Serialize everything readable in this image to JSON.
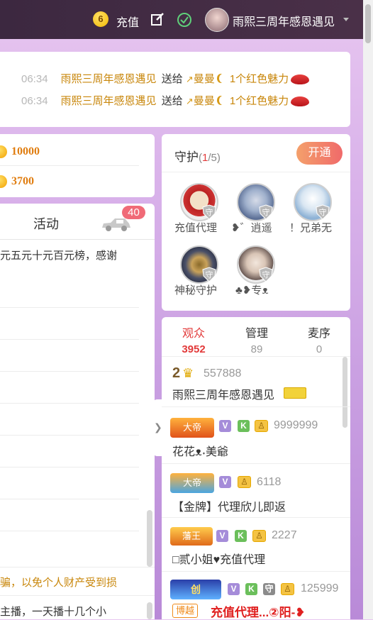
{
  "topbar": {
    "coin_level": "6",
    "recharge_label": "充值",
    "user_name": "雨熙三周年感恩遇见"
  },
  "gift_feed": [
    {
      "time": "06:34",
      "sender": "雨熙三周年感恩遇见",
      "verb": "送给",
      "receiver": "曼曼",
      "gift": "1个红色魅力"
    },
    {
      "time": "06:34",
      "sender": "雨熙三周年感恩遇见",
      "verb": "送给",
      "receiver": "曼曼",
      "gift": "1个红色魅力"
    }
  ],
  "rank": {
    "values": [
      "10000",
      "3700"
    ]
  },
  "chat": {
    "tab_label": "活动",
    "badge_count": "40",
    "first_line": "元五元十元百元榜，感谢",
    "warning": "骗，以免个人财产受到损",
    "last_line": "主播，一天播十几个小"
  },
  "guard": {
    "title": "守护",
    "count_current": "1",
    "count_total": "/5",
    "open_label": "开通",
    "members": [
      {
        "name": "充值代理"
      },
      {
        "name": "❥゛逍遥"
      },
      {
        "name": "！兄弟无"
      },
      {
        "name": "神秘守护"
      },
      {
        "name": "♣❥专ᴥ"
      }
    ],
    "shield_label": "守"
  },
  "audience": {
    "tabs": [
      {
        "label": "观众",
        "count": "3952"
      },
      {
        "label": "管理",
        "count": "89"
      },
      {
        "label": "麦序",
        "count": "0"
      }
    ],
    "rows": [
      {
        "rank_num": "2",
        "id": "557888",
        "name": "雨熙三周年感恩遇见"
      },
      {
        "title_badge": "大帝",
        "id": "9999999",
        "name": "花花ᴥ˖美爺"
      },
      {
        "title_badge": "大帝",
        "id": "6118",
        "name": "【金牌】代理欣儿即返"
      },
      {
        "title_badge": "藩王",
        "id": "2227",
        "name": "□贰小姐♥充值代理"
      },
      {
        "title_badge": "创",
        "id": "125999",
        "tag": "博越",
        "name": "充值代理...②阳-❥"
      }
    ],
    "badge_v": "V",
    "badge_k": "K",
    "badge_guard": "守"
  },
  "colors": {
    "accent_red": "#e23a3a",
    "gold": "#c8860a",
    "topbar": "#3c2840"
  }
}
